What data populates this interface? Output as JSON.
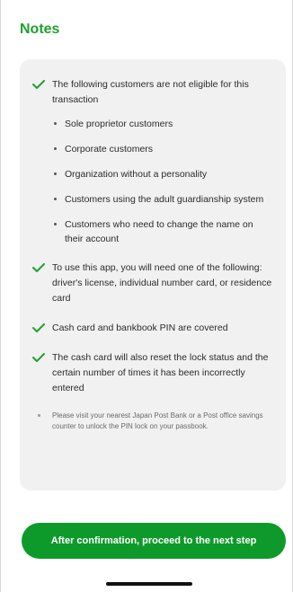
{
  "header": {
    "title": "Notes"
  },
  "notes": {
    "intro": "The following customers are not eligible for this transaction",
    "excluded_customers": [
      "Sole proprietor customers",
      "Corporate customers",
      "Organization without a personality",
      "Customers using the adult guardianship system",
      "Customers who need to change the name on their account"
    ],
    "requirements": [
      "To use this app, you will need one of the following: driver's license, individual number card, or residence card",
      "Cash card and bankbook PIN are covered",
      "The cash card will also reset the lock status and the certain number of times it has been incorrectly entered"
    ],
    "footnote": "Please visit your nearest Japan Post Bank or a Post office savings counter to unlock the PIN lock on your passbook."
  },
  "cta": {
    "label": "After confirmation, proceed to the next step"
  },
  "colors": {
    "accent": "#1fa12f",
    "button": "#0e9a2a",
    "card_bg": "#f1f1f1"
  },
  "icons": {
    "check": "check-icon",
    "bullet": "bullet-dot-icon"
  }
}
